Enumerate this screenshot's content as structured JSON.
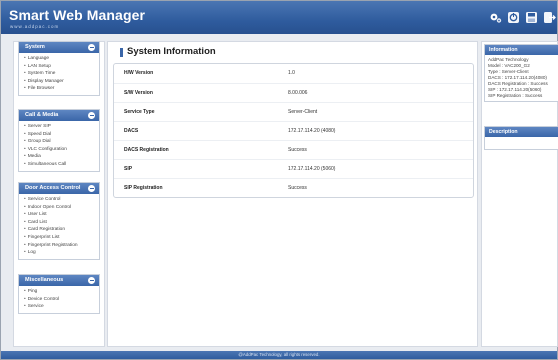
{
  "header": {
    "brand": "Smart Web Manager",
    "brand_sub": "www.addpac.com",
    "icons": [
      "settings-icon",
      "reboot-icon",
      "save-icon",
      "logout-icon"
    ]
  },
  "sidebar": {
    "groups": [
      {
        "title": "System",
        "items": [
          "Language",
          "LAN Setup",
          "System Time",
          "Display Manager",
          "File Browser"
        ]
      },
      {
        "title": "Call & Media",
        "items": [
          "Server SIP",
          "Speed Dial",
          "Group Dial",
          "VLC Configuration",
          "Media",
          "Simultaneous Call"
        ]
      },
      {
        "title": "Door Access Control",
        "items": [
          "Service Control",
          "Indoor Open Control",
          "User List",
          "Card List",
          "Card Registration",
          "Fingerprint List",
          "Fingerprint Registration",
          "Log"
        ]
      },
      {
        "title": "Miscellaneous",
        "items": [
          "Ping",
          "Device Control",
          "Service"
        ]
      }
    ]
  },
  "main": {
    "title": "System Information",
    "rows": [
      {
        "label": "H/W Version",
        "value": "1.0"
      },
      {
        "label": "S/W Version",
        "value": "8.00.006"
      },
      {
        "label": "Service Type",
        "value": "Server-Client"
      },
      {
        "label": "DACS",
        "value": "172.17.114.20 (4080)"
      },
      {
        "label": "DACS Registration",
        "value": "Success"
      },
      {
        "label": "SIP",
        "value": "172.17.114.20 (5060)"
      },
      {
        "label": "SIP Registration",
        "value": "Success"
      }
    ]
  },
  "right": {
    "info_title": "Information",
    "info_lines": [
      "AddPac Technology",
      "Model : VAC200_G2",
      "Type : Server-Client",
      "DACS : 172.17.114.20(4080)",
      "DACS Registration : Success",
      "SIP : 172.17.114.20(5060)",
      "SIP Registration : Success"
    ],
    "desc_title": "Description"
  },
  "footer": {
    "text": "@AddPac Technology, all rights reserved."
  },
  "colors": {
    "header": "#2f5c9e",
    "accent": "#3a66a8",
    "background": "#e9ecf1"
  }
}
